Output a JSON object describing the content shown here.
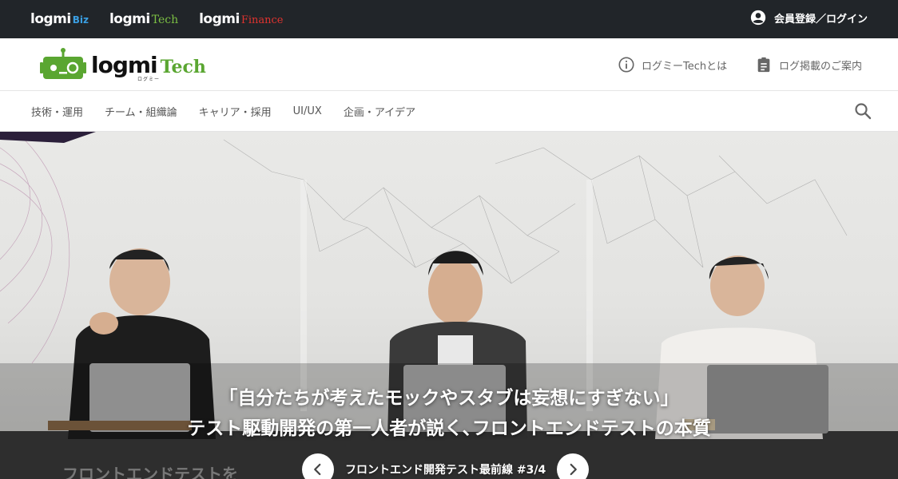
{
  "topbar": {
    "brands": [
      {
        "word": "logmi",
        "suffix": "Biz"
      },
      {
        "word": "logmi",
        "suffix": "Tech"
      },
      {
        "word": "logmi",
        "suffix": "Finance"
      }
    ],
    "login_label": "会員登録／ログイン",
    "login_icon": "account-circle-icon"
  },
  "header": {
    "logo_word": "logmi",
    "logo_suffix": "Tech",
    "logo_kana": "ログミー",
    "about_label": "ログミーTechとは",
    "about_icon": "info-icon",
    "ad_label": "ログ掲載のご案内",
    "ad_icon": "clipboard-icon"
  },
  "categories": [
    "技術・運用",
    "チーム・組織論",
    "キャリア・採用",
    "UI/UX",
    "企画・アイデア"
  ],
  "search_icon": "search-icon",
  "hero": {
    "title_line1": "「自分たちが考えたモックやスタブは妄想にすぎない」",
    "title_line2": "テスト駆動開発の第一人者が説く､フロントエンドテストの本質",
    "series_label": "フロントエンド開発テスト最前線 #3/4",
    "ghost_text": "フロントエンドテストを"
  },
  "colors": {
    "topbar_bg": "#212529",
    "biz": "#3a9fe3",
    "tech": "#7bbf43",
    "finance": "#e0332f",
    "logo_green": "#5aa631"
  }
}
